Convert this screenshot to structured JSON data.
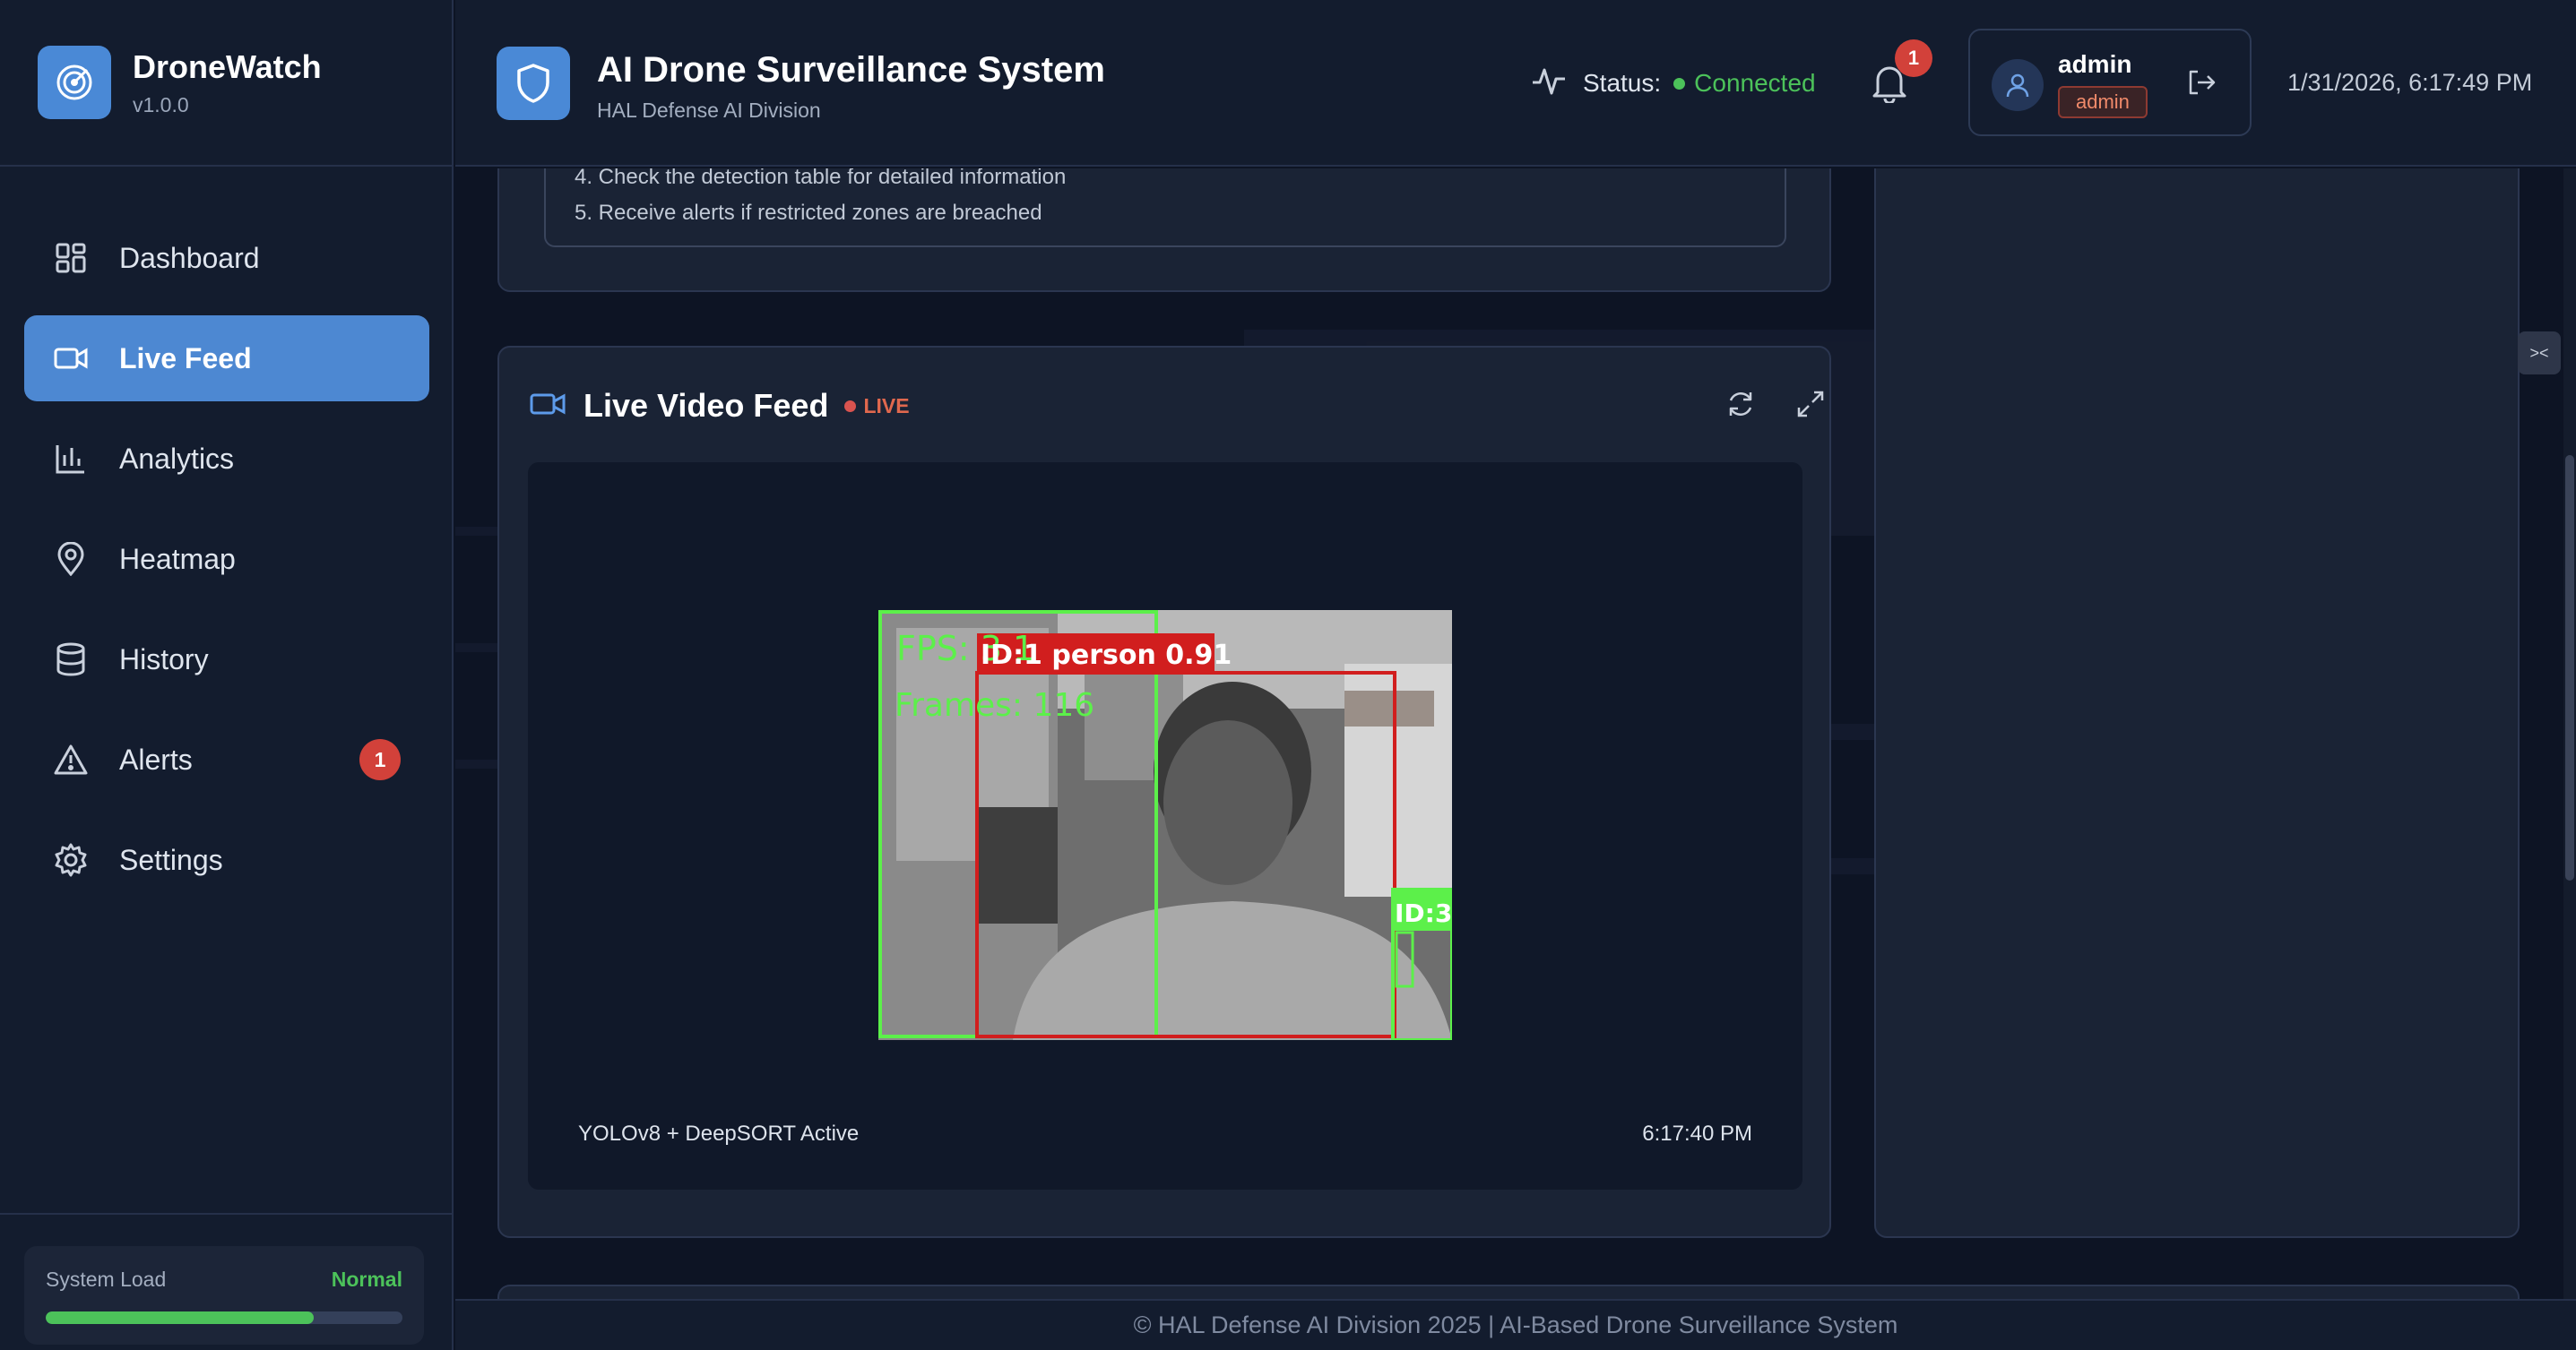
{
  "brand": {
    "name": "DroneWatch",
    "version": "v1.0.0"
  },
  "sidebar": {
    "items": [
      {
        "label": "Dashboard",
        "icon": "grid-icon",
        "active": false
      },
      {
        "label": "Live Feed",
        "icon": "video-icon",
        "active": true
      },
      {
        "label": "Analytics",
        "icon": "bar-chart-icon",
        "active": false
      },
      {
        "label": "Heatmap",
        "icon": "map-pin-icon",
        "active": false
      },
      {
        "label": "History",
        "icon": "database-icon",
        "active": false
      },
      {
        "label": "Alerts",
        "icon": "warning-icon",
        "active": false,
        "badge": "1"
      },
      {
        "label": "Settings",
        "icon": "gear-icon",
        "active": false
      }
    ],
    "system_load": {
      "label": "System Load",
      "status": "Normal",
      "fill_fraction": 0.75
    }
  },
  "header": {
    "title": "AI Drone Surveillance System",
    "subtitle": "HAL Defense AI Division",
    "status_label": "Status:",
    "status_value": "Connected",
    "notification_count": "1",
    "user": {
      "name": "admin",
      "role": "admin"
    },
    "datetime": "1/31/2026, 6:17:49 PM"
  },
  "instructions": {
    "items": [
      "4. Check the detection table for detailed information",
      "5. Receive alerts if restricted zones are breached"
    ]
  },
  "feed": {
    "title": "Live Video Feed",
    "live_label": "LIVE",
    "model_status": "YOLOv8 + DeepSORT Active",
    "timestamp": "6:17:40 PM",
    "overlay": {
      "fps_text": "FPS: 3.1",
      "frames_text": "Frames: 116",
      "box1_label": "ID:1 person 0.91",
      "box2_label": "ID:3"
    }
  },
  "footer": {
    "text": "© HAL Defense AI Division 2025 | AI-Based Drone Surveillance System"
  },
  "colors": {
    "accent": "#4d88d2",
    "success": "#4cc25a",
    "danger": "#d2413a",
    "background": "#0d1424",
    "panel": "#1a2335"
  }
}
